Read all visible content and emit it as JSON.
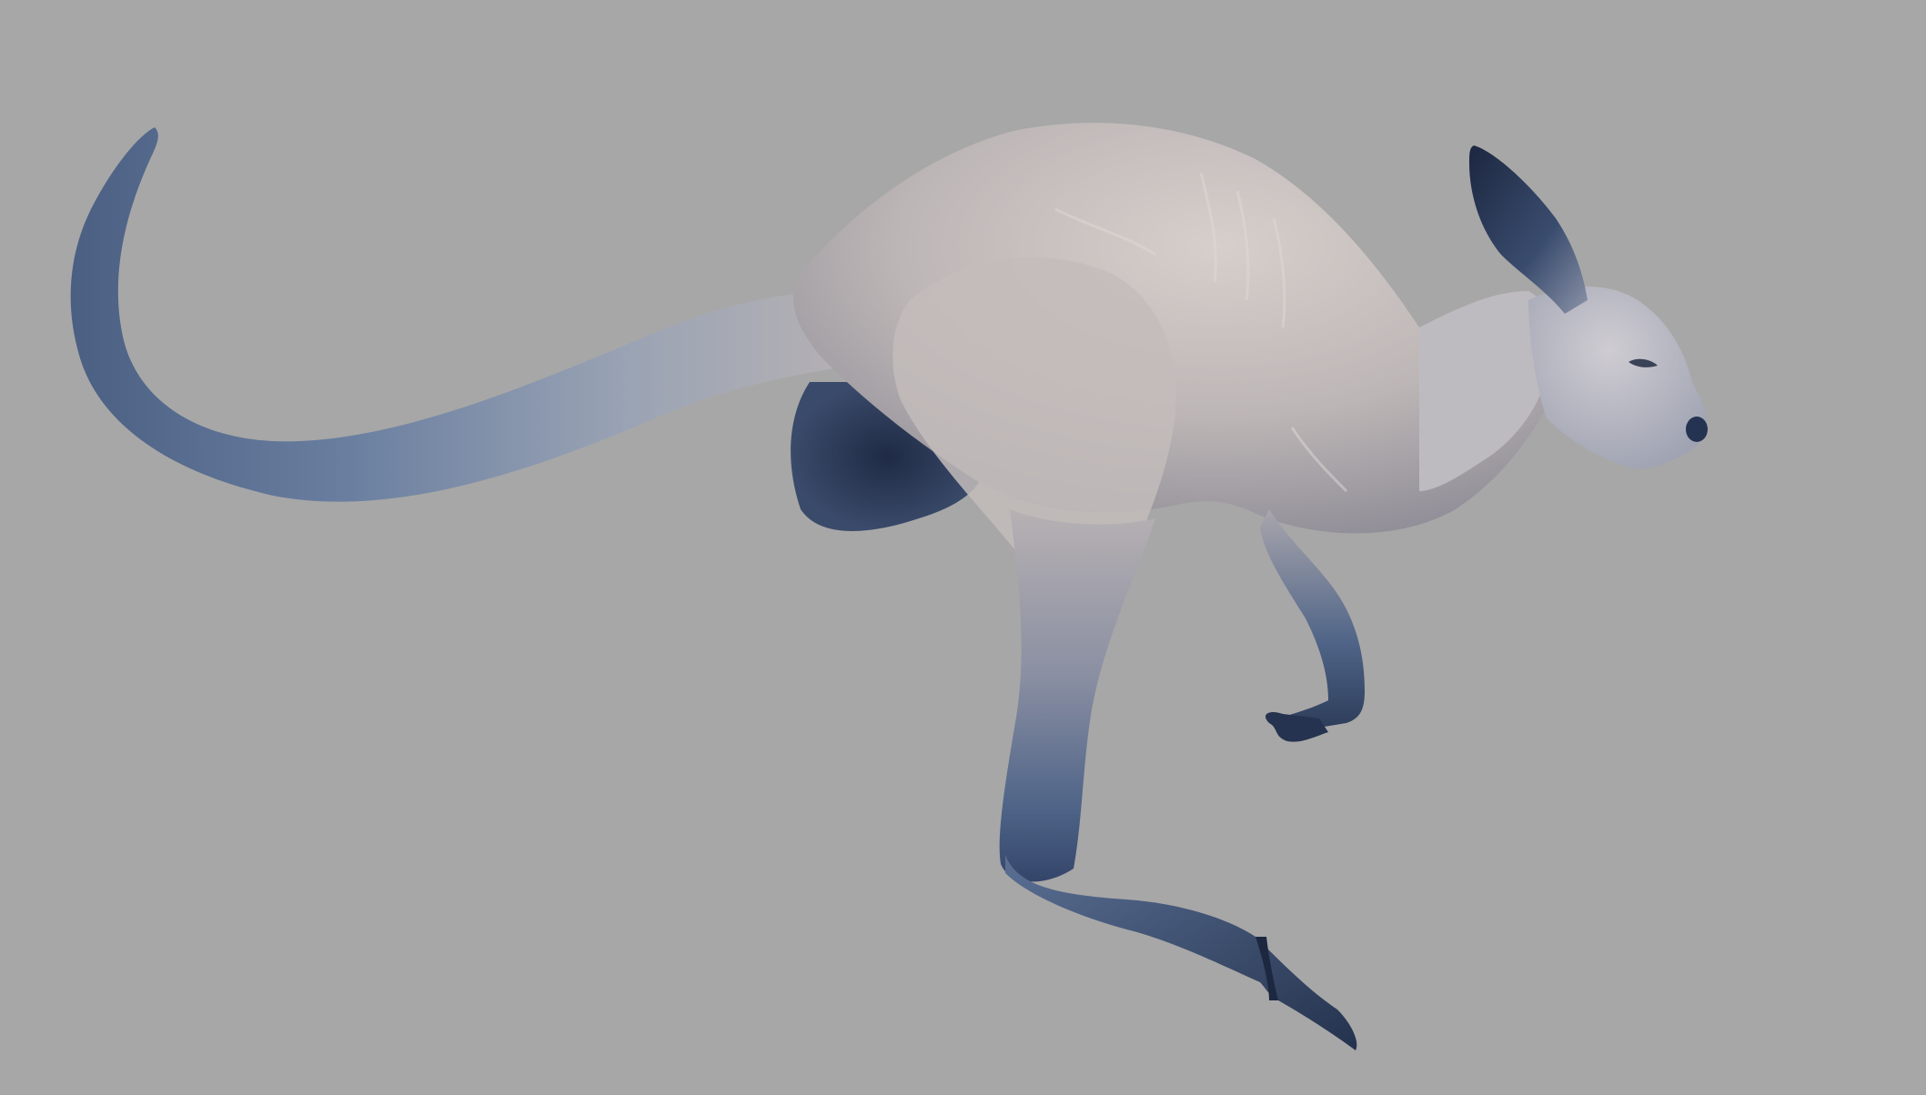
{
  "scene": {
    "subject": "kangaroo-sculpt",
    "colors": {
      "background": "#a7a7a7",
      "body_light": "#cfc7c2",
      "body_mid": "#b3aeb0",
      "body_shadow": "#8f8c94",
      "extremity_blue": "#5c7396",
      "extremity_dark": "#2b3a55",
      "ear_inner": "#1f2a40"
    }
  }
}
